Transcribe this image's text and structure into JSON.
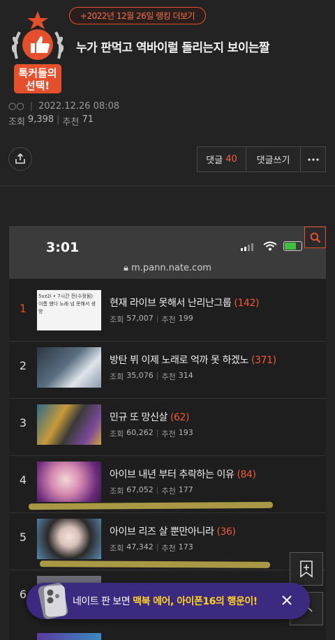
{
  "header": {
    "ranking_link": "+2022년 12월 26일 랭킹 더보기",
    "badge_text_line1": "톡커들의",
    "badge_text_line2": "선택!",
    "title": "누가 판먹고 역바이럴 돌리는지 보이는짤"
  },
  "meta": {
    "author": "○○",
    "date": "2022.12.26 08:08",
    "views_label": "조회",
    "views": "9,398",
    "likes_label": "추천",
    "likes": "71"
  },
  "actions": {
    "comments_label": "댓글",
    "comments_count": "40",
    "write_comment_label": "댓글쓰기"
  },
  "screenshot": {
    "clock": "3:01",
    "url": "m.pann.nate.com",
    "rows": [
      {
        "rank": "1",
        "title": "현재 라이브 못해서 난리난그룹",
        "comments": "(142)",
        "views": "57,007",
        "likes": "199",
        "thumb_text": "5vz2i • 7시간 전(수정됨)\n이름 쌨다 노래 넘 못해서 생방"
      },
      {
        "rank": "2",
        "title": "방탄 뷔 이제 노래로 억까 못 하겠노",
        "comments": "(371)",
        "views": "35,076",
        "likes": "314"
      },
      {
        "rank": "3",
        "title": "민규 또 망신살",
        "comments": "(62)",
        "views": "60,262",
        "likes": "193"
      },
      {
        "rank": "4",
        "title": "아이브 내년 부터 추락하는 이유",
        "comments": "(84)",
        "views": "67,052",
        "likes": "177"
      },
      {
        "rank": "5",
        "title": "아이브 리즈 살 뿐만아니라",
        "comments": "(36)",
        "views": "47,342",
        "likes": "173"
      },
      {
        "rank": "6",
        "title": "",
        "comments": "",
        "views": "",
        "likes": ""
      }
    ],
    "views_label": "조회",
    "likes_label": "추천"
  },
  "promo": {
    "prefix": "네이트 판 보면 ",
    "highlight": "맥북 에어, 아이폰16의 행운이!"
  },
  "colors": {
    "accent": "#e4502b",
    "background": "#232323",
    "promo_bg": "#3c2a80",
    "promo_highlight": "#ffd21f"
  },
  "icons": [
    "share-icon",
    "more-icon",
    "search-icon",
    "lock-icon",
    "wifi-icon",
    "bookmark-add-icon",
    "close-icon",
    "chevron-up-icon"
  ]
}
